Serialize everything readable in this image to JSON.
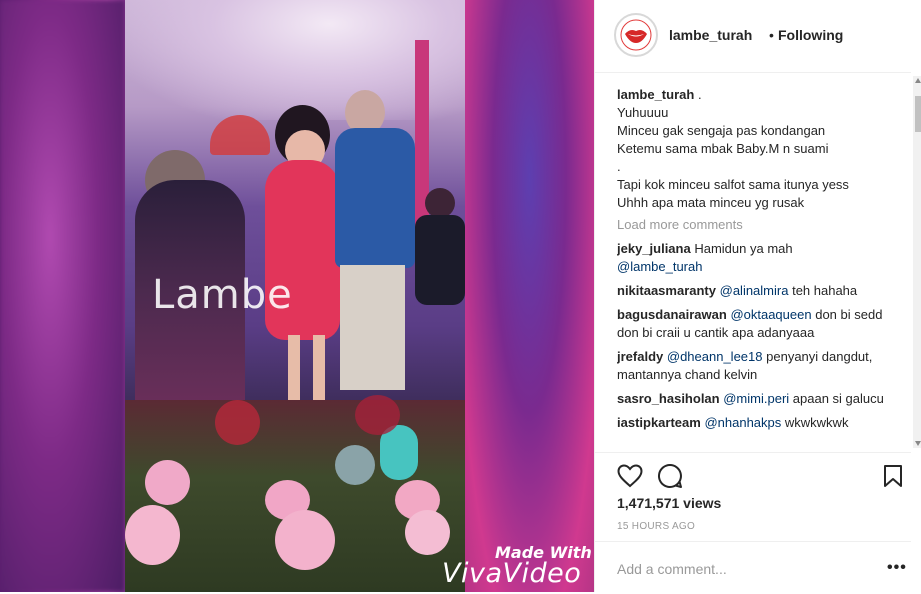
{
  "media": {
    "watermark": "Lambe",
    "made_with": "Made With",
    "app_logo": "VivaVideo"
  },
  "header": {
    "avatar_icon": "lambe-turah-lips-logo-icon",
    "username": "lambe_turah",
    "separator": "•",
    "follow_status": "Following"
  },
  "caption": {
    "username": "lambe_turah",
    "suffix": ".",
    "lines": [
      "Yuhuuuu",
      "Minceu gak sengaja pas kondangan",
      "Ketemu sama mbak Baby.M n suami",
      ".",
      "Tapi kok minceu salfot sama itunya yess",
      "Uhhh apa mata minceu yg rusak"
    ]
  },
  "load_more": "Load more comments",
  "comments": [
    {
      "user": "jeky_juliana",
      "text": "Hamidun ya mah",
      "mention": "@lambe_turah",
      "after": ""
    },
    {
      "user": "nikitaasmaranty",
      "text": "",
      "mention": "@alinalmira",
      "after": "teh hahaha"
    },
    {
      "user": "bagusdanairawan",
      "text": "",
      "mention": "@oktaaqueen",
      "after": "don bi sedd don bi craii u cantik apa adanyaaa"
    },
    {
      "user": "jrefaldy",
      "text": "",
      "mention": "@dheann_lee18",
      "after": "penyanyi dangdut, mantannya chand kelvin"
    },
    {
      "user": "sasro_hasiholan",
      "text": "",
      "mention": "@mimi.peri",
      "after": "apaan si galucu"
    },
    {
      "user": "iastipkarteam",
      "text": "",
      "mention": "@nhanhakps",
      "after": "wkwkwkwk"
    }
  ],
  "actions": {
    "like_icon": "heart-icon",
    "comment_icon": "comment-bubble-icon",
    "save_icon": "bookmark-icon",
    "views": "1,471,571 views",
    "time": "15 HOURS AGO"
  },
  "add_comment": {
    "placeholder": "Add a comment...",
    "more": "•••"
  }
}
